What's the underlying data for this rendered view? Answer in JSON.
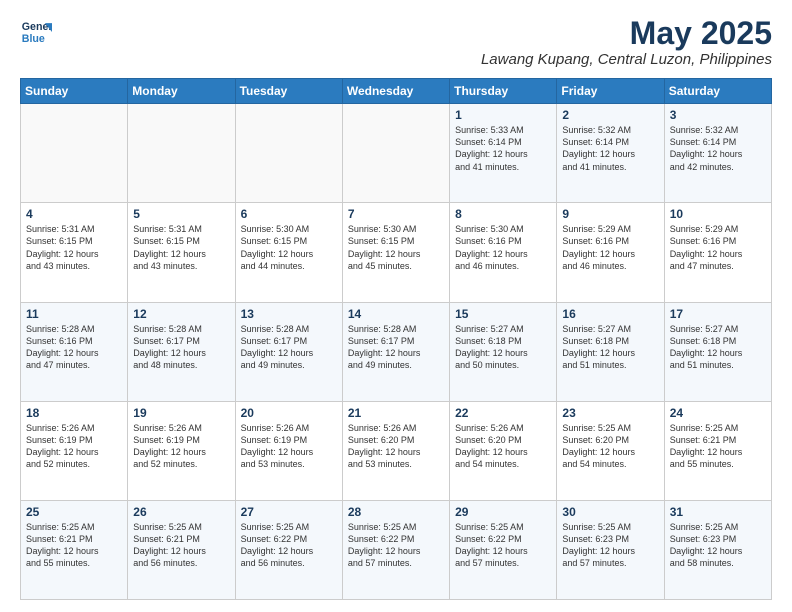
{
  "header": {
    "logo_line1": "General",
    "logo_line2": "Blue",
    "title": "May 2025",
    "subtitle": "Lawang Kupang, Central Luzon, Philippines"
  },
  "days_of_week": [
    "Sunday",
    "Monday",
    "Tuesday",
    "Wednesday",
    "Thursday",
    "Friday",
    "Saturday"
  ],
  "weeks": [
    [
      {
        "day": "",
        "detail": ""
      },
      {
        "day": "",
        "detail": ""
      },
      {
        "day": "",
        "detail": ""
      },
      {
        "day": "",
        "detail": ""
      },
      {
        "day": "1",
        "detail": "Sunrise: 5:33 AM\nSunset: 6:14 PM\nDaylight: 12 hours\nand 41 minutes."
      },
      {
        "day": "2",
        "detail": "Sunrise: 5:32 AM\nSunset: 6:14 PM\nDaylight: 12 hours\nand 41 minutes."
      },
      {
        "day": "3",
        "detail": "Sunrise: 5:32 AM\nSunset: 6:14 PM\nDaylight: 12 hours\nand 42 minutes."
      }
    ],
    [
      {
        "day": "4",
        "detail": "Sunrise: 5:31 AM\nSunset: 6:15 PM\nDaylight: 12 hours\nand 43 minutes."
      },
      {
        "day": "5",
        "detail": "Sunrise: 5:31 AM\nSunset: 6:15 PM\nDaylight: 12 hours\nand 43 minutes."
      },
      {
        "day": "6",
        "detail": "Sunrise: 5:30 AM\nSunset: 6:15 PM\nDaylight: 12 hours\nand 44 minutes."
      },
      {
        "day": "7",
        "detail": "Sunrise: 5:30 AM\nSunset: 6:15 PM\nDaylight: 12 hours\nand 45 minutes."
      },
      {
        "day": "8",
        "detail": "Sunrise: 5:30 AM\nSunset: 6:16 PM\nDaylight: 12 hours\nand 46 minutes."
      },
      {
        "day": "9",
        "detail": "Sunrise: 5:29 AM\nSunset: 6:16 PM\nDaylight: 12 hours\nand 46 minutes."
      },
      {
        "day": "10",
        "detail": "Sunrise: 5:29 AM\nSunset: 6:16 PM\nDaylight: 12 hours\nand 47 minutes."
      }
    ],
    [
      {
        "day": "11",
        "detail": "Sunrise: 5:28 AM\nSunset: 6:16 PM\nDaylight: 12 hours\nand 47 minutes."
      },
      {
        "day": "12",
        "detail": "Sunrise: 5:28 AM\nSunset: 6:17 PM\nDaylight: 12 hours\nand 48 minutes."
      },
      {
        "day": "13",
        "detail": "Sunrise: 5:28 AM\nSunset: 6:17 PM\nDaylight: 12 hours\nand 49 minutes."
      },
      {
        "day": "14",
        "detail": "Sunrise: 5:28 AM\nSunset: 6:17 PM\nDaylight: 12 hours\nand 49 minutes."
      },
      {
        "day": "15",
        "detail": "Sunrise: 5:27 AM\nSunset: 6:18 PM\nDaylight: 12 hours\nand 50 minutes."
      },
      {
        "day": "16",
        "detail": "Sunrise: 5:27 AM\nSunset: 6:18 PM\nDaylight: 12 hours\nand 51 minutes."
      },
      {
        "day": "17",
        "detail": "Sunrise: 5:27 AM\nSunset: 6:18 PM\nDaylight: 12 hours\nand 51 minutes."
      }
    ],
    [
      {
        "day": "18",
        "detail": "Sunrise: 5:26 AM\nSunset: 6:19 PM\nDaylight: 12 hours\nand 52 minutes."
      },
      {
        "day": "19",
        "detail": "Sunrise: 5:26 AM\nSunset: 6:19 PM\nDaylight: 12 hours\nand 52 minutes."
      },
      {
        "day": "20",
        "detail": "Sunrise: 5:26 AM\nSunset: 6:19 PM\nDaylight: 12 hours\nand 53 minutes."
      },
      {
        "day": "21",
        "detail": "Sunrise: 5:26 AM\nSunset: 6:20 PM\nDaylight: 12 hours\nand 53 minutes."
      },
      {
        "day": "22",
        "detail": "Sunrise: 5:26 AM\nSunset: 6:20 PM\nDaylight: 12 hours\nand 54 minutes."
      },
      {
        "day": "23",
        "detail": "Sunrise: 5:25 AM\nSunset: 6:20 PM\nDaylight: 12 hours\nand 54 minutes."
      },
      {
        "day": "24",
        "detail": "Sunrise: 5:25 AM\nSunset: 6:21 PM\nDaylight: 12 hours\nand 55 minutes."
      }
    ],
    [
      {
        "day": "25",
        "detail": "Sunrise: 5:25 AM\nSunset: 6:21 PM\nDaylight: 12 hours\nand 55 minutes."
      },
      {
        "day": "26",
        "detail": "Sunrise: 5:25 AM\nSunset: 6:21 PM\nDaylight: 12 hours\nand 56 minutes."
      },
      {
        "day": "27",
        "detail": "Sunrise: 5:25 AM\nSunset: 6:22 PM\nDaylight: 12 hours\nand 56 minutes."
      },
      {
        "day": "28",
        "detail": "Sunrise: 5:25 AM\nSunset: 6:22 PM\nDaylight: 12 hours\nand 57 minutes."
      },
      {
        "day": "29",
        "detail": "Sunrise: 5:25 AM\nSunset: 6:22 PM\nDaylight: 12 hours\nand 57 minutes."
      },
      {
        "day": "30",
        "detail": "Sunrise: 5:25 AM\nSunset: 6:23 PM\nDaylight: 12 hours\nand 57 minutes."
      },
      {
        "day": "31",
        "detail": "Sunrise: 5:25 AM\nSunset: 6:23 PM\nDaylight: 12 hours\nand 58 minutes."
      }
    ]
  ]
}
